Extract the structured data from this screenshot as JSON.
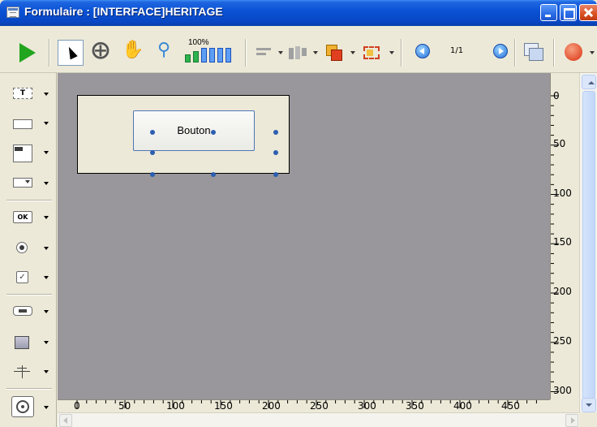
{
  "window": {
    "title": "Formulaire : [INTERFACE]HERITAGE"
  },
  "toolbar": {
    "zoom_label": "100%",
    "page_indicator": "1/1",
    "tools": [
      "play-icon",
      "select-arrow-icon",
      "tab-order-icon",
      "hand-icon",
      "zoom-icon",
      "zoom-bars-icon",
      "align-icon",
      "distribute-icon",
      "layers-icon",
      "group-icon",
      "page-prev-icon",
      "page-next-icon",
      "windows-icon",
      "close-form-icon"
    ]
  },
  "palette": {
    "items": [
      "text-object-icon",
      "input-field-icon",
      "list-field-icon",
      "combo-field-icon",
      "button-object-icon",
      "radio-button-icon",
      "checkbox-icon",
      "tab-control-icon",
      "rectangle-icon",
      "splitter-icon",
      "circle-object-icon"
    ],
    "button_icon_label": "OK"
  },
  "form": {
    "button_label": "Bouton"
  },
  "rulers": {
    "horizontal": [
      "0",
      "50",
      "100",
      "150",
      "200",
      "250",
      "300",
      "350",
      "400",
      "450"
    ],
    "vertical": [
      "0",
      "50",
      "100",
      "150",
      "200",
      "250",
      "300"
    ]
  },
  "colors": {
    "title_bar": "#0a53d6",
    "editor_background": "#99979b",
    "form_background": "#ece9d8",
    "selection_handles": "#2c5fb0",
    "play_green": "#22a51e"
  }
}
